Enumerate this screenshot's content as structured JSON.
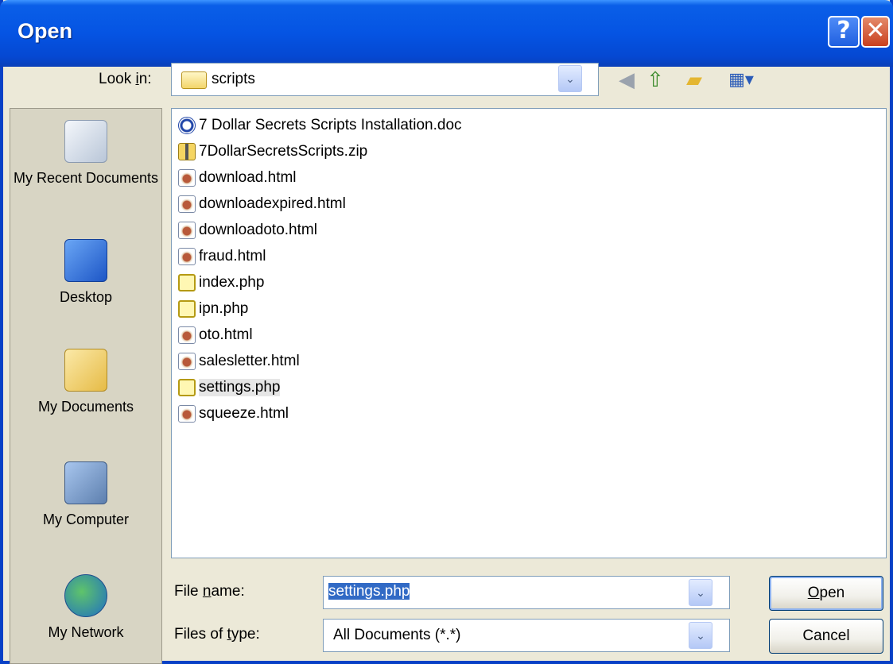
{
  "window": {
    "title": "Open",
    "help_glyph": "?",
    "close_glyph": "✕"
  },
  "lookin": {
    "label_pre": "Look ",
    "label_accel": "i",
    "label_post": "n:",
    "value": "scripts",
    "toolbar": {
      "back_icon": "back-icon",
      "up_icon": "up-folder-icon",
      "new_folder_icon": "new-folder-icon",
      "views_icon": "views-menu-icon"
    }
  },
  "places": [
    {
      "label": "My Recent Documents",
      "icon": "recent-documents-icon"
    },
    {
      "label": "Desktop",
      "icon": "desktop-icon"
    },
    {
      "label": "My Documents",
      "icon": "my-documents-icon"
    },
    {
      "label": "My Computer",
      "icon": "my-computer-icon"
    },
    {
      "label": "My Network",
      "icon": "my-network-icon"
    }
  ],
  "files": [
    {
      "name": "7 Dollar Secrets Scripts Installation.doc",
      "type": "doc"
    },
    {
      "name": "7DollarSecretsScripts.zip",
      "type": "zip"
    },
    {
      "name": "download.html",
      "type": "html"
    },
    {
      "name": "downloadexpired.html",
      "type": "html"
    },
    {
      "name": "downloadoto.html",
      "type": "html"
    },
    {
      "name": "fraud.html",
      "type": "html"
    },
    {
      "name": "index.php",
      "type": "php"
    },
    {
      "name": "ipn.php",
      "type": "php"
    },
    {
      "name": "oto.html",
      "type": "html"
    },
    {
      "name": "salesletter.html",
      "type": "html"
    },
    {
      "name": "settings.php",
      "type": "php",
      "selected": true
    },
    {
      "name": "squeeze.html",
      "type": "html"
    }
  ],
  "filename": {
    "label_pre": "File ",
    "label_accel": "n",
    "label_post": "ame:",
    "value": "settings.php"
  },
  "filetype": {
    "label_pre": "Files of ",
    "label_accel": "t",
    "label_post": "ype:",
    "value": "All Documents (*.*)"
  },
  "buttons": {
    "open_accel": "O",
    "open_rest": "pen",
    "cancel": "Cancel"
  }
}
